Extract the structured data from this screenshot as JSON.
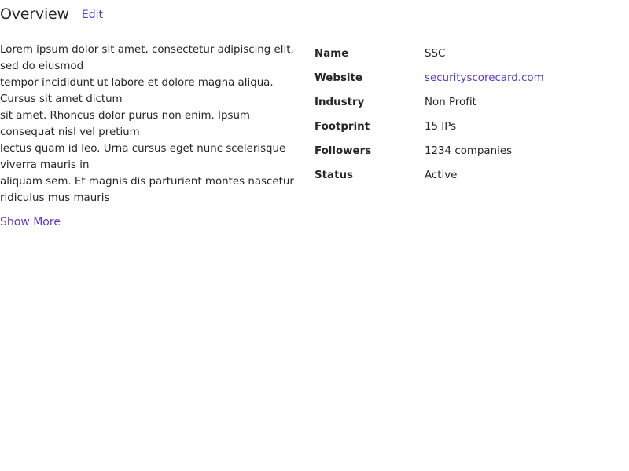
{
  "header": {
    "title": "Overview",
    "edit_label": "Edit"
  },
  "description": {
    "lines": [
      "Lorem ipsum dolor sit amet, consectetur adipiscing elit, sed do eiusmod",
      "tempor incididunt ut labore et dolore magna aliqua. Cursus sit amet dictum",
      "sit amet. Rhoncus dolor purus non enim. Ipsum consequat nisl vel pretium",
      "lectus quam id leo. Urna cursus eget nunc scelerisque viverra mauris in",
      "aliquam sem. Et magnis dis parturient montes nascetur ridiculus mus mauris"
    ],
    "show_more_label": "Show More"
  },
  "details": {
    "rows": [
      {
        "label": "Name",
        "value": "SSC"
      },
      {
        "label": "Website",
        "value": "securityscorecard.com"
      },
      {
        "label": "Industry",
        "value": "Non Profit"
      },
      {
        "label": "Footprint",
        "value": "15 IPs"
      },
      {
        "label": "Followers",
        "value": "1234 companies"
      },
      {
        "label": "Status",
        "value": "Active"
      }
    ]
  },
  "colors": {
    "accent": "#5b38d0",
    "text": "#262626"
  }
}
